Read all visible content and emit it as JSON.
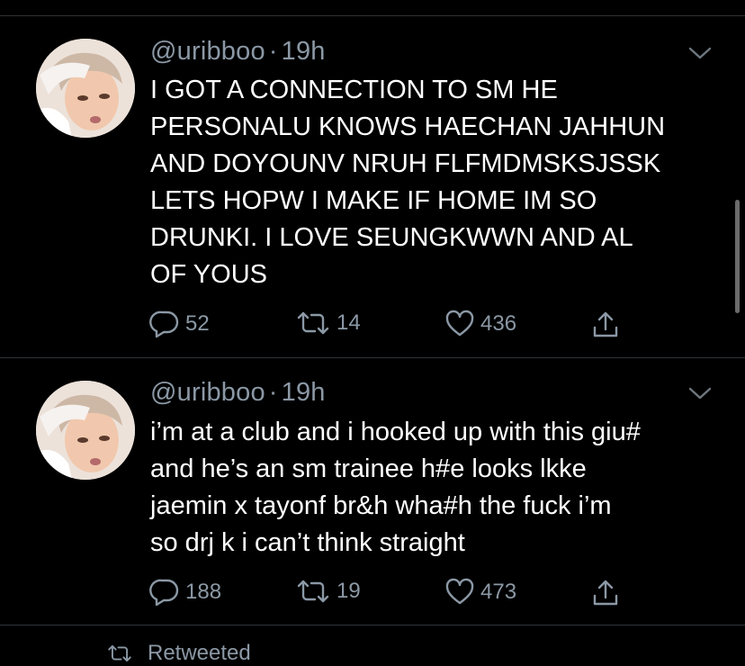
{
  "tweets": [
    {
      "handle": "@uribboo",
      "separator": "·",
      "time": "19h",
      "lines": [
        "I GOT A CONNECTION TO SM HE",
        "PERSONALU KNOWS HAECHAN JAHHUN",
        "AND DOYOUNV NRUH FLFMDMSKSJSSK",
        "LETS HOPW I MAKE IF HOME IM SO",
        "DRUNKI. I LOVE SEUNGKWWN AND AL",
        "OF YOUS"
      ],
      "replies": "52",
      "retweets": "14",
      "likes": "436"
    },
    {
      "handle": "@uribboo",
      "separator": "·",
      "time": "19h",
      "lines": [
        "i’m at a club and i hooked up with this giu#",
        "and he’s an sm trainee h#e looks lkke",
        "jaemin x tayonf br&h wha#h the fuck i’m",
        "so drj k i can’t think straight"
      ],
      "replies": "188",
      "retweets": "19",
      "likes": "473"
    }
  ],
  "footer": {
    "label": "Retweeted"
  },
  "icons": {
    "reply": "reply-icon",
    "retweet": "retweet-icon",
    "like": "like-icon",
    "share": "share-icon",
    "caret": "chevron-down-icon"
  },
  "colors": {
    "background": "#000000",
    "text": "#ffffff",
    "secondary": "#8b98a5",
    "divider": "#2f3336"
  }
}
